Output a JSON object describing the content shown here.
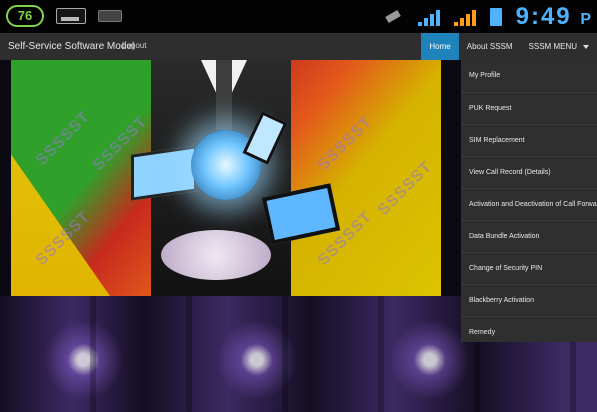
{
  "status_bar": {
    "battery_level": "76",
    "time": "9:49",
    "ampm_fragment": "P"
  },
  "app": {
    "title": "Self-Service Software Model",
    "logout_label": "Logout"
  },
  "nav": {
    "tabs": [
      {
        "label": "Home"
      },
      {
        "label": "About SSSM"
      },
      {
        "label": "SSSM MENU"
      }
    ]
  },
  "menu": {
    "items": [
      {
        "label": "My Profile"
      },
      {
        "label": "PUK Request"
      },
      {
        "label": "SIM Replacement"
      },
      {
        "label": "View Call Record (Details)"
      },
      {
        "label": "Activation and Deactivation of Call Forwarding"
      },
      {
        "label": "Data Bundle Activation"
      },
      {
        "label": "Change of Security PIN"
      },
      {
        "label": "Blackberry Activation"
      },
      {
        "label": "Remedy"
      }
    ]
  },
  "hero": {
    "watermark_text": "SSSSST"
  },
  "colors": {
    "accent": "#1e82bb",
    "status_blue": "#4fb2ff",
    "battery_green": "#7fd44c",
    "signal_orange": "#ff9d1a",
    "menu_bg": "#2f2f2f",
    "appbar_bg": "#2e2e2e"
  }
}
